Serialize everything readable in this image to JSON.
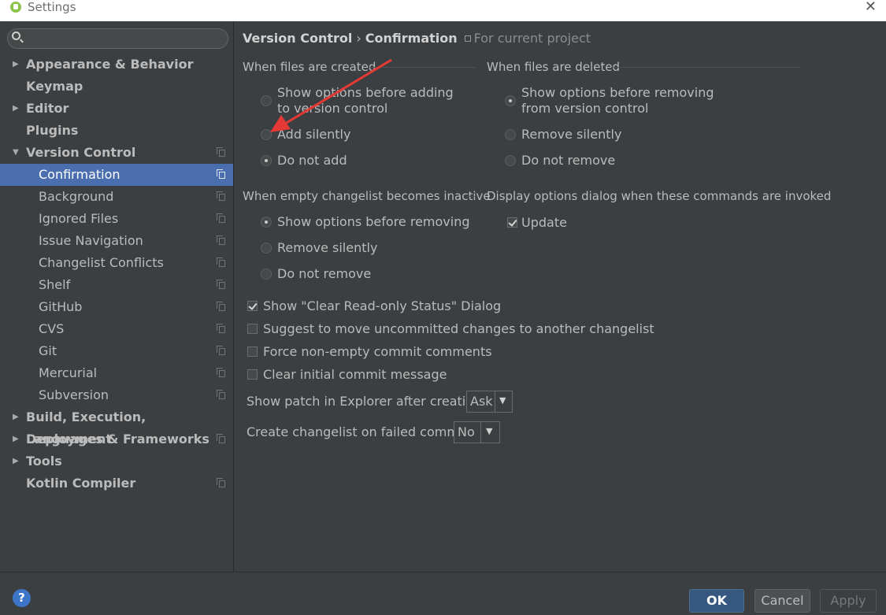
{
  "window": {
    "title": "Settings",
    "close_glyph": "✕"
  },
  "sidebar": {
    "search_placeholder": "",
    "items": [
      {
        "label": "Appearance & Behavior",
        "level": "top",
        "expandable": true,
        "expanded": false,
        "icon": false
      },
      {
        "label": "Keymap",
        "level": "top",
        "expandable": false,
        "icon": false
      },
      {
        "label": "Editor",
        "level": "top",
        "expandable": true,
        "expanded": false,
        "icon": false
      },
      {
        "label": "Plugins",
        "level": "top",
        "expandable": false,
        "icon": false
      },
      {
        "label": "Version Control",
        "level": "top",
        "expandable": true,
        "expanded": true,
        "icon": true
      },
      {
        "label": "Confirmation",
        "level": "child",
        "selected": true,
        "icon": true
      },
      {
        "label": "Background",
        "level": "child",
        "icon": true
      },
      {
        "label": "Ignored Files",
        "level": "child",
        "icon": true
      },
      {
        "label": "Issue Navigation",
        "level": "child",
        "icon": true
      },
      {
        "label": "Changelist Conflicts",
        "level": "child",
        "icon": true
      },
      {
        "label": "Shelf",
        "level": "child",
        "icon": true
      },
      {
        "label": "GitHub",
        "level": "child",
        "icon": true
      },
      {
        "label": "CVS",
        "level": "child",
        "icon": true
      },
      {
        "label": "Git",
        "level": "child",
        "icon": true
      },
      {
        "label": "Mercurial",
        "level": "child",
        "icon": true
      },
      {
        "label": "Subversion",
        "level": "child",
        "icon": true
      },
      {
        "label": "Build, Execution, Deployment",
        "level": "top",
        "expandable": true,
        "expanded": false,
        "icon": false
      },
      {
        "label": "Languages & Frameworks",
        "level": "top",
        "expandable": true,
        "expanded": false,
        "icon": true
      },
      {
        "label": "Tools",
        "level": "top",
        "expandable": true,
        "expanded": false,
        "icon": false
      },
      {
        "label": "Kotlin Compiler",
        "level": "top",
        "expandable": false,
        "icon": true
      }
    ]
  },
  "breadcrumb": {
    "parent": "Version Control",
    "separator": "›",
    "current": "Confirmation",
    "scope": "For current project"
  },
  "files_created": {
    "title": "When files are created",
    "options": [
      {
        "line1": "Show options before adding",
        "line2": "to version control",
        "checked": false
      },
      {
        "line1": "Add silently",
        "checked": false
      },
      {
        "line1": "Do not add",
        "checked": true
      }
    ]
  },
  "files_deleted": {
    "title": "When files are deleted",
    "options": [
      {
        "line1": "Show options before removing",
        "line2": "from version control",
        "checked": true
      },
      {
        "line1": "Remove silently",
        "checked": false
      },
      {
        "line1": "Do not remove",
        "checked": false
      }
    ]
  },
  "empty_changelist": {
    "title": "When empty changelist becomes inactive",
    "options": [
      {
        "line1": "Show options before removing",
        "checked": true
      },
      {
        "line1": "Remove silently",
        "checked": false
      },
      {
        "line1": "Do not remove",
        "checked": false
      }
    ]
  },
  "display_options": {
    "title": "Display options dialog when these commands are invoked",
    "update_label": "Update",
    "update_checked": true
  },
  "checkboxes": [
    {
      "label": "Show \"Clear Read-only Status\" Dialog",
      "checked": true
    },
    {
      "label": "Suggest to move uncommitted changes to another changelist",
      "checked": false
    },
    {
      "label": "Force non-empty commit comments",
      "checked": false
    },
    {
      "label": "Clear initial commit message",
      "checked": false
    }
  ],
  "show_patch": {
    "label": "Show patch in Explorer after creation:",
    "value": "Ask"
  },
  "create_changelist": {
    "label": "Create changelist on failed commit:",
    "value": "No"
  },
  "footer": {
    "help": "?",
    "ok": "OK",
    "cancel": "Cancel",
    "apply": "Apply"
  },
  "colors": {
    "selection": "#4b6eaf",
    "annotation_arrow": "#e53935",
    "ok_button": "#365880"
  },
  "icons": {
    "dropdown": "▼",
    "expand": "▶",
    "collapse": "▼"
  }
}
